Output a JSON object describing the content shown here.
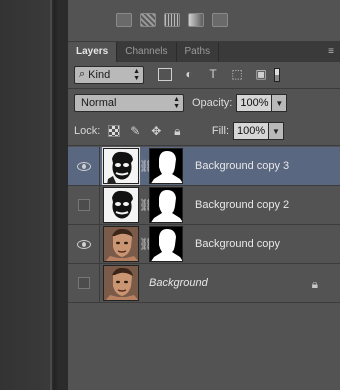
{
  "tabs": [
    {
      "label": "Layers",
      "active": true
    },
    {
      "label": "Channels",
      "active": false
    },
    {
      "label": "Paths",
      "active": false
    }
  ],
  "tab_menu_icon": "panel-menu-icon",
  "filter": {
    "kind_label": "Kind"
  },
  "blend": {
    "mode": "Normal",
    "opacity_label": "Opacity:",
    "opacity_value": "100%"
  },
  "lock": {
    "label": "Lock:",
    "fill_label": "Fill:",
    "fill_value": "100%"
  },
  "layers": [
    {
      "name": "Background copy 3",
      "visible": true,
      "selected": true,
      "thumb": "bw-face"
    },
    {
      "name": "Background copy 2",
      "visible": false,
      "selected": false,
      "thumb": "bw-face"
    },
    {
      "name": "Background copy",
      "visible": true,
      "selected": false,
      "thumb": "color-face"
    },
    {
      "name": "Background",
      "visible": false,
      "selected": false,
      "thumb": "color-face",
      "locked": true,
      "italic": true
    }
  ],
  "colors": {
    "panel": "#535353",
    "selected_row": "#5a6780",
    "tab_bar": "#3a3a3a"
  }
}
